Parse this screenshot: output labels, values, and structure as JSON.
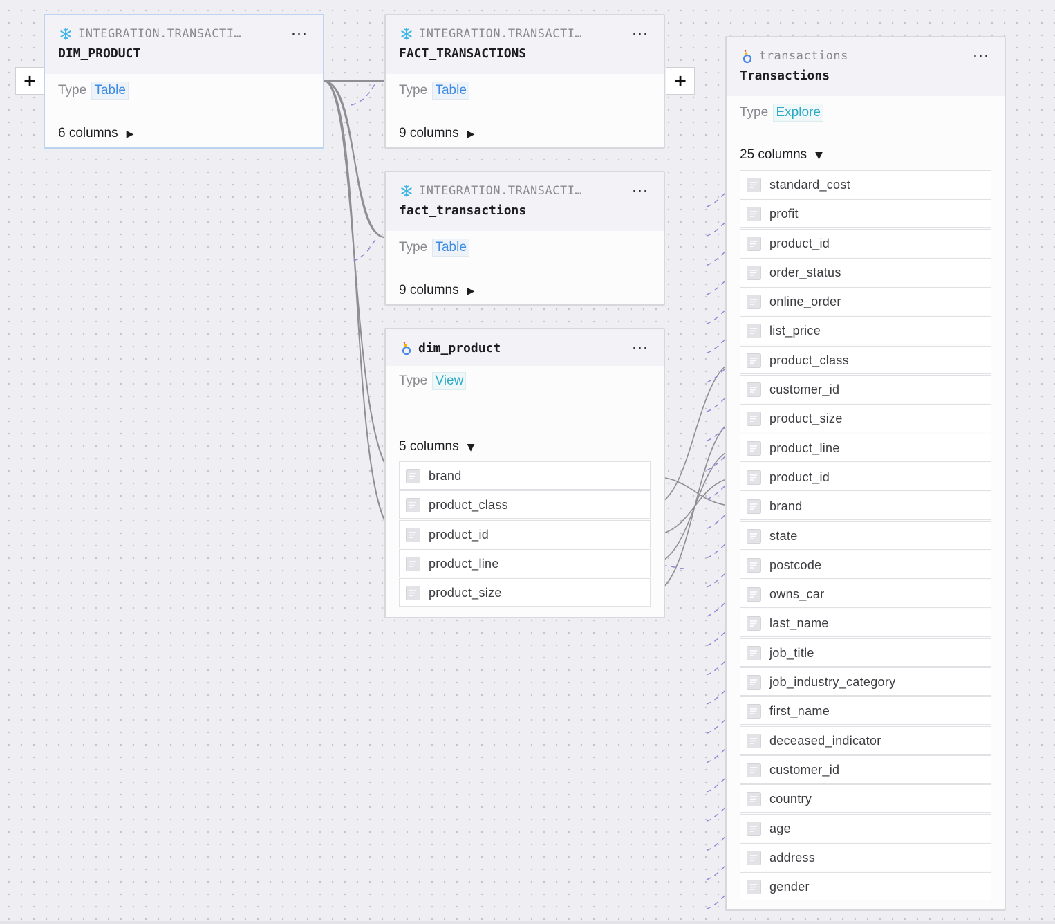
{
  "nodes": {
    "dim_product_table": {
      "schema": "INTEGRATION.TRANSACTI…",
      "name": "DIM_PRODUCT",
      "type_label": "Type",
      "type_value": "Table",
      "columns_label": "6 columns",
      "menu": "···"
    },
    "fact_transactions_upper": {
      "schema": "INTEGRATION.TRANSACTI…",
      "name": "FACT_TRANSACTIONS",
      "type_label": "Type",
      "type_value": "Table",
      "columns_label": "9 columns",
      "menu": "···"
    },
    "fact_transactions_lower": {
      "schema": "INTEGRATION.TRANSACTI…",
      "name": "fact_transactions",
      "type_label": "Type",
      "type_value": "Table",
      "columns_label": "9 columns",
      "menu": "···"
    },
    "dim_product_view": {
      "name": "dim_product",
      "type_label": "Type",
      "type_value": "View",
      "columns_label": "5 columns",
      "menu": "···",
      "columns": [
        "brand",
        "product_class",
        "product_id",
        "product_line",
        "product_size"
      ]
    },
    "transactions_explore": {
      "schema": "transactions",
      "name": "Transactions",
      "type_label": "Type",
      "type_value": "Explore",
      "columns_label": "25 columns",
      "menu": "···",
      "columns": [
        "standard_cost",
        "profit",
        "product_id",
        "order_status",
        "online_order",
        "list_price",
        "product_class",
        "customer_id",
        "product_size",
        "product_line",
        "product_id",
        "brand",
        "state",
        "postcode",
        "owns_car",
        "last_name",
        "job_title",
        "job_industry_category",
        "first_name",
        "deceased_indicator",
        "customer_id",
        "country",
        "age",
        "address",
        "gender"
      ]
    }
  },
  "buttons": {
    "expand_left": "+",
    "expand_right": "+"
  },
  "colors": {
    "snowflake": "#3fb5e6",
    "edge_solid": "#8f8e94",
    "edge_dashed": "#8f84d8",
    "selected_border": "#bcd3f1"
  }
}
